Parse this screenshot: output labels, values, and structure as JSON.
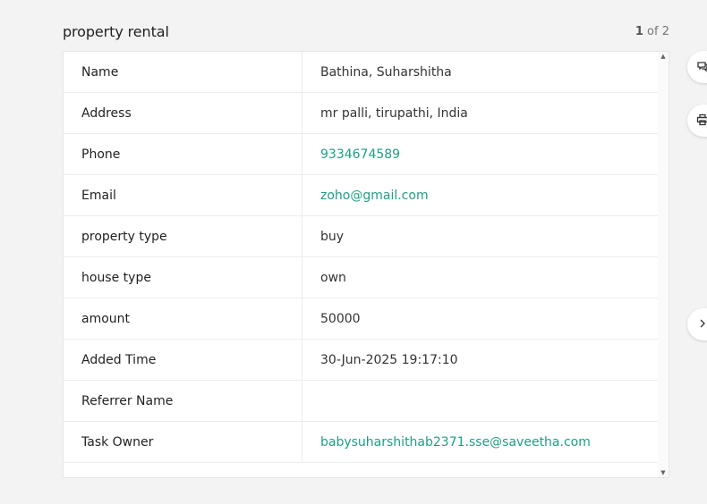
{
  "header": {
    "title": "property rental",
    "pager_current": "1",
    "pager_rest": " of 2"
  },
  "record": {
    "rows": [
      {
        "label": "Name",
        "value": "Bathina, Suharshitha",
        "link": false
      },
      {
        "label": "Address",
        "value": "mr palli, tirupathi, India",
        "link": false
      },
      {
        "label": "Phone",
        "value": "9334674589",
        "link": true
      },
      {
        "label": "Email",
        "value": "zoho@gmail.com",
        "link": true
      },
      {
        "label": "property type",
        "value": "buy",
        "link": false
      },
      {
        "label": "house type",
        "value": "own",
        "link": false
      },
      {
        "label": "amount",
        "value": "50000",
        "link": false
      },
      {
        "label": "Added Time",
        "value": "30-Jun-2025 19:17:10",
        "link": false
      },
      {
        "label": "Referrer Name",
        "value": "",
        "link": false
      },
      {
        "label": "Task Owner",
        "value": "babysuharshithab2371.sse@saveetha.com",
        "link": true
      }
    ]
  },
  "scrollbar": {
    "up_glyph": "▲",
    "down_glyph": "▼"
  },
  "side_buttons": [
    {
      "icon": "comment-icon"
    },
    {
      "icon": "print-icon"
    },
    {
      "icon": "expand-icon"
    }
  ],
  "colors": {
    "background": "#f3f3f3",
    "link": "#1f9e83",
    "border": "#ececec"
  }
}
